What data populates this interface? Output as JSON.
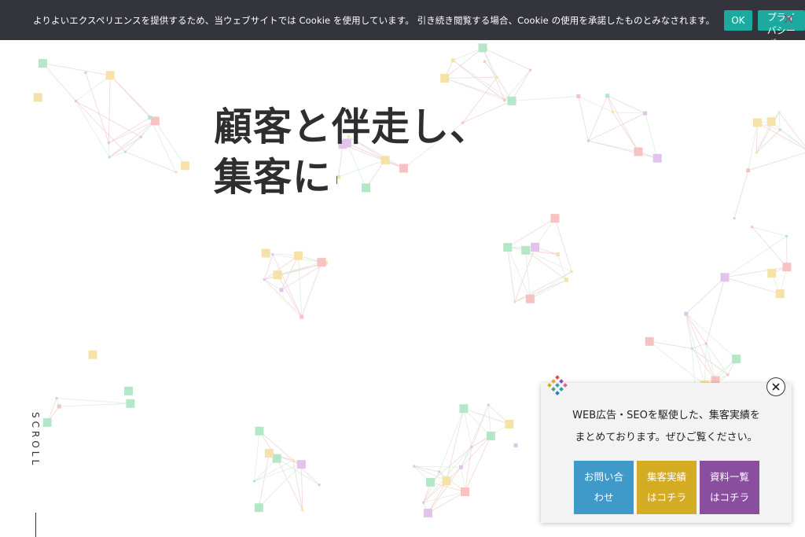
{
  "cookie_bar": {
    "message": "よりよいエクスペリエンスを提供するため、当ウェブサイトでは Cookie を使用しています。 引き続き閲覧する場合、Cookie の使用を承諾したものとみなされます。",
    "ok_label": "OK",
    "privacy_label": "プライバシーポリシー",
    "close_icon": "close-icon",
    "background": "#34343c",
    "button_color": "#1ba9a0"
  },
  "hero": {
    "line1": "顧客と伴走し、",
    "line2": "集客に"
  },
  "scroll": {
    "label": "SCROLL"
  },
  "popup": {
    "logo_icon": "diamond-logo-icon",
    "close_icon": "close-circle-icon",
    "text_line1": "WEB広告・SEOを駆使した、集客実績を",
    "text_line2": "まとめております。ぜひご覧ください。",
    "buttons": [
      {
        "line1": "お問い合",
        "line2": "わせ",
        "color": "#3f9ac9"
      },
      {
        "line1": "集客実績",
        "line2": "はコチラ",
        "color": "#d4ac23"
      },
      {
        "line1": "資料一覧",
        "line2": "はコチラ",
        "color": "#8a4e9e"
      }
    ]
  },
  "colors": {
    "node_palette": [
      "#b4e6c8",
      "#f7c2c2",
      "#e0c4ec",
      "#f6e2a8"
    ]
  }
}
